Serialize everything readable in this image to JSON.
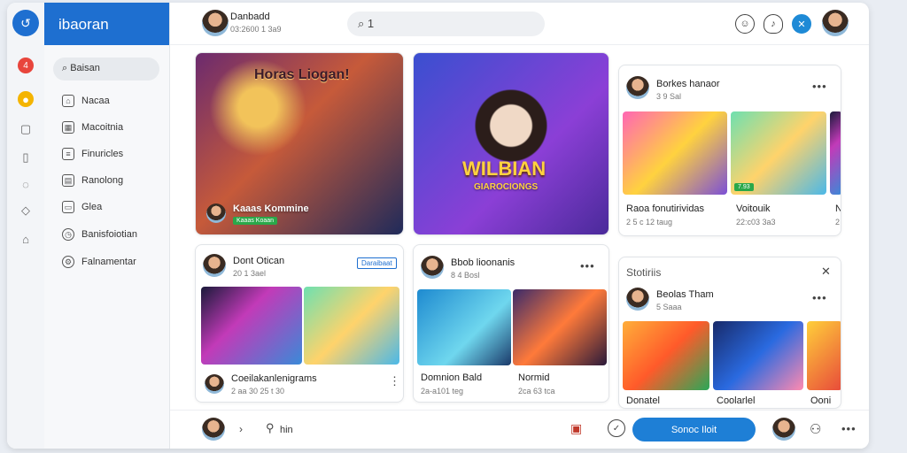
{
  "app": {
    "title": "ibaoran"
  },
  "rail": {
    "badge": "4"
  },
  "sidebar": {
    "search_label": "Baisan",
    "items": [
      {
        "label": "Nacaa",
        "icon": "home-icon"
      },
      {
        "label": "Macoitnia",
        "icon": "grid-icon"
      },
      {
        "label": "Finuricles",
        "icon": "list-icon"
      },
      {
        "label": "Ranolong",
        "icon": "calendar-icon"
      },
      {
        "label": "Glea",
        "icon": "bookmark-icon"
      },
      {
        "label": "Banisfoiotian",
        "icon": "compass-icon"
      },
      {
        "label": "Falnamentar",
        "icon": "settings-icon"
      }
    ]
  },
  "topbar": {
    "user_name": "Danbadd",
    "user_meta": "03:2600 1 3a9",
    "search_value": "1"
  },
  "hero1": {
    "title": "Horas Liogan!",
    "caption": "Kaaas Kommine",
    "tag": "Kaaas Koaan"
  },
  "hero2": {
    "title": "WILBIAN",
    "subtitle": "GIAROCIONGS"
  },
  "card_top_right": {
    "name": "Borkes hanaor",
    "meta": "3 9 Sal",
    "items": [
      {
        "title": "Raoa fonutirividas",
        "meta": "2 5 c 12 taug"
      },
      {
        "title": "Voitouik",
        "meta": "22:c03 3a3"
      },
      {
        "title": "N",
        "meta": "2"
      }
    ],
    "tag": "7.93"
  },
  "card_mid_left": {
    "name": "Dont Otican",
    "meta": "20 1 3ael",
    "badge": "Daraibaat",
    "footer_title": "Coeilakanlenigrams",
    "footer_meta": "2 aa 30 25 t 30"
  },
  "card_mid_center": {
    "name": "Bbob lioonanis",
    "meta": "8 4 Bosl",
    "items": [
      {
        "title": "Domnion Bald",
        "meta": "2a-a101 teg"
      },
      {
        "title": "Normid",
        "meta": "2ca 63 tca"
      }
    ]
  },
  "card_bottom_right": {
    "header": "Stotiriis",
    "name": "Beolas Tham",
    "meta": "5 Saaa",
    "items": [
      {
        "title": "Donatel"
      },
      {
        "title": "Coolarlel"
      },
      {
        "title": "Ooni"
      }
    ]
  },
  "bottombar": {
    "label": "hin",
    "cta": "Sonoc Iloit"
  }
}
